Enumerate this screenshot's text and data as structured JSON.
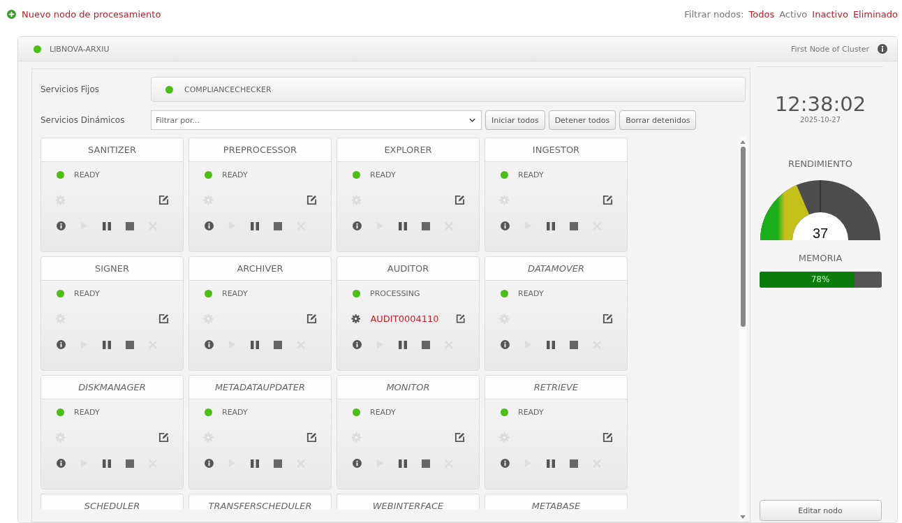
{
  "new_node_link": "Nuevo nodo de procesamiento",
  "filter": {
    "label": "Filtrar nodos:",
    "options": [
      {
        "label": "Todos",
        "selected": false
      },
      {
        "label": "Activo",
        "selected": true
      },
      {
        "label": "Inactivo",
        "selected": false
      },
      {
        "label": "Eliminado",
        "selected": false
      }
    ]
  },
  "node": {
    "name": "LIBNOVA-ARXIU",
    "note": "First Node of Cluster",
    "fixed_services": {
      "label": "Servicios Fijos",
      "service": "COMPLIANCECHECKER"
    },
    "dynamic_services": {
      "label": "Servicios Dinámicos",
      "placeholder": "Filtrar por...",
      "buttons": [
        "Iniciar todos",
        "Detener todos",
        "Borrar detenidos"
      ]
    },
    "services": [
      {
        "name": "SANITIZER",
        "italic": false,
        "status": "READY"
      },
      {
        "name": "PREPROCESSOR",
        "italic": false,
        "status": "READY"
      },
      {
        "name": "EXPLORER",
        "italic": false,
        "status": "READY"
      },
      {
        "name": "INGESTOR",
        "italic": false,
        "status": "READY"
      },
      {
        "name": "SIGNER",
        "italic": false,
        "status": "READY"
      },
      {
        "name": "ARCHIVER",
        "italic": false,
        "status": "READY"
      },
      {
        "name": "AUDITOR",
        "italic": false,
        "status": "PROCESSING",
        "job": "AUDIT0004110"
      },
      {
        "name": "DATAMOVER",
        "italic": true,
        "status": "READY"
      },
      {
        "name": "DISKMANAGER",
        "italic": true,
        "status": "READY"
      },
      {
        "name": "METADATAUPDATER",
        "italic": true,
        "status": "READY"
      },
      {
        "name": "MONITOR",
        "italic": true,
        "status": "READY"
      },
      {
        "name": "RETRIEVE",
        "italic": true,
        "status": "READY"
      },
      {
        "name": "SCHEDULER",
        "italic": true
      },
      {
        "name": "TRANSFERSCHEDULER",
        "italic": true
      },
      {
        "name": "WEBINTERFACE",
        "italic": true
      },
      {
        "name": "METABASE",
        "italic": true
      }
    ],
    "clock": {
      "time": "12:38:02",
      "date": "2025-10-27"
    },
    "performance": {
      "title": "RENDIMIENTO",
      "level": 0.37,
      "reading": "37"
    },
    "memory": {
      "title": "MEMORIA",
      "level": 0.78,
      "reading": "78%"
    },
    "edit_button": "Editar nodo"
  }
}
